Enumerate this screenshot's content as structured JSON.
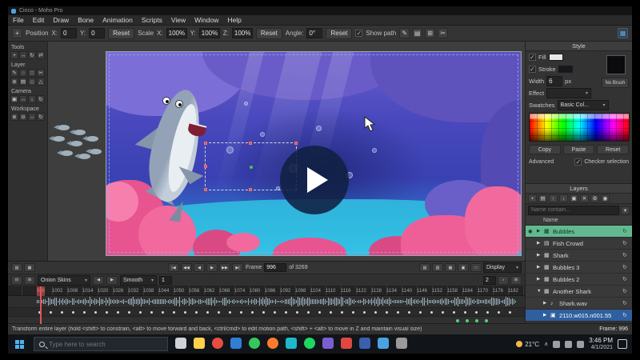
{
  "window": {
    "title": "Cinco - Moho Pro",
    "menus": [
      {
        "label": "File"
      },
      {
        "label": "Edit"
      },
      {
        "label": "Draw"
      },
      {
        "label": "Bone"
      },
      {
        "label": "Animation"
      },
      {
        "label": "Scripts"
      },
      {
        "label": "View"
      },
      {
        "label": "Window"
      },
      {
        "label": "Help"
      }
    ]
  },
  "transform_toolbar": {
    "position_label": "Position",
    "position_fields": [
      {
        "label": "X:",
        "value": "0"
      },
      {
        "label": "Y:",
        "value": "0"
      }
    ],
    "reset_label": "Reset",
    "scale_label": "Scale",
    "scale_fields": [
      {
        "label": "X:",
        "value": "100%"
      },
      {
        "label": "Y:",
        "value": "100%"
      },
      {
        "label": "Z:",
        "value": "100%"
      }
    ],
    "angle_label": "Angle:",
    "angle_value": "0°",
    "show_path_label": "Show path",
    "icons": [
      {
        "name": "freehand-icon",
        "glyph": "✎"
      },
      {
        "name": "layer-stack-icon",
        "glyph": "▤"
      },
      {
        "name": "grid-icon",
        "glyph": "⊞"
      },
      {
        "name": "scissors-icon",
        "glyph": "✂"
      }
    ],
    "dock_icon": {
      "name": "dock-layout-icon",
      "glyph": "▦"
    }
  },
  "tools_panel": {
    "title": "Tools",
    "sections": [
      {
        "label": "",
        "icons": [
          {
            "name": "transform-tool",
            "glyph": "+"
          },
          {
            "name": "translate-tool",
            "glyph": "↔"
          },
          {
            "name": "rotate-tool",
            "glyph": "↻"
          },
          {
            "name": "scale-tool",
            "glyph": "⇄"
          }
        ]
      },
      {
        "label": "Layer",
        "icons": [
          {
            "name": "draw-tool",
            "glyph": "✎"
          },
          {
            "name": "ellipse-tool",
            "glyph": "○"
          },
          {
            "name": "rectangle-tool",
            "glyph": "□"
          },
          {
            "name": "cut-tool",
            "glyph": "✂"
          },
          {
            "name": "add-point-tool",
            "glyph": "⊕"
          },
          {
            "name": "fill-tool",
            "glyph": "▤"
          },
          {
            "name": "shape-tool",
            "glyph": "◇"
          },
          {
            "name": "polygon-tool",
            "glyph": "△"
          }
        ]
      },
      {
        "label": "Camera",
        "icons": [
          {
            "name": "camera-track-tool",
            "glyph": "▣"
          },
          {
            "name": "camera-pan-tool",
            "glyph": "↔"
          },
          {
            "name": "camera-tilt-tool",
            "glyph": "↕"
          },
          {
            "name": "camera-roll-tool",
            "glyph": "↻"
          }
        ]
      },
      {
        "label": "Workspace",
        "icons": [
          {
            "name": "zoom-in-tool",
            "glyph": "⊕"
          },
          {
            "name": "zoom-out-tool",
            "glyph": "⊖"
          },
          {
            "name": "pan-workspace-tool",
            "glyph": "↔"
          },
          {
            "name": "orbit-workspace-tool",
            "glyph": "↻"
          }
        ]
      }
    ]
  },
  "style_panel": {
    "title": "Style",
    "fill_label": "Fill",
    "stroke_label": "Stroke",
    "width_label": "Width",
    "width_value": "6",
    "width_unit": "px",
    "effect_label": "Effect",
    "no_brush_label": "No Brush",
    "swatches_label": "Swatches",
    "swatches_value": "Basic Col...",
    "copy_label": "Copy",
    "paste_label": "Paste",
    "reset_label": "Reset",
    "advanced_label": "Advanced",
    "checker_label": "Checker selection"
  },
  "layers_panel": {
    "title": "Layers",
    "header_icons": [
      {
        "name": "new-layer-icon",
        "glyph": "+"
      },
      {
        "name": "folder-icon",
        "glyph": "▤"
      },
      {
        "name": "move-up-icon",
        "glyph": "↑"
      },
      {
        "name": "move-down-icon",
        "glyph": "↓"
      },
      {
        "name": "duplicate-icon",
        "glyph": "▣"
      },
      {
        "name": "delete-icon",
        "glyph": "✕"
      },
      {
        "name": "settings-gear-icon",
        "glyph": "⚙"
      },
      {
        "name": "visibility-icon",
        "glyph": "◉"
      }
    ],
    "filter_placeholder": "Name contain...",
    "name_column": "Name",
    "rows": [
      {
        "label": "Bubbles",
        "glyph": "▦",
        "icon_name": "group-layer-icon",
        "eye": true,
        "selected": "green",
        "expanded": false,
        "indent": 0
      },
      {
        "label": "Fish Crowd",
        "glyph": "▤",
        "icon_name": "folder-layer-icon",
        "eye": false,
        "selected": "",
        "expanded": false,
        "indent": 0
      },
      {
        "label": "Shark",
        "glyph": "▦",
        "icon_name": "group-layer-icon",
        "eye": false,
        "selected": "",
        "expanded": false,
        "indent": 0
      },
      {
        "label": "Bubbles 3",
        "glyph": "▦",
        "icon_name": "group-layer-icon",
        "eye": false,
        "selected": "",
        "expanded": false,
        "indent": 0
      },
      {
        "label": "Bubbles 2",
        "glyph": "▦",
        "icon_name": "group-layer-icon",
        "eye": false,
        "selected": "",
        "expanded": false,
        "indent": 0
      },
      {
        "label": "Another Shark",
        "glyph": "▦",
        "icon_name": "group-layer-icon",
        "eye": false,
        "selected": "",
        "expanded": true,
        "indent": 0
      },
      {
        "label": "Shark.wav",
        "glyph": "♪",
        "icon_name": "audio-layer-icon",
        "eye": false,
        "selected": "",
        "expanded": false,
        "indent": 1
      },
      {
        "label": "2110.w015.n001.55",
        "glyph": "▣",
        "icon_name": "image-layer-icon",
        "eye": false,
        "selected": "blue",
        "expanded": false,
        "indent": 1
      }
    ]
  },
  "timeline": {
    "left_icons": [
      {
        "name": "timeline-settings-icon",
        "glyph": "▤"
      },
      {
        "name": "timeline-options-icon",
        "glyph": "▦"
      }
    ],
    "playback_buttons": [
      {
        "name": "jump-start-button",
        "glyph": "|◀"
      },
      {
        "name": "prev-keyframe-button",
        "glyph": "◀◀"
      },
      {
        "name": "step-back-button",
        "glyph": "◀"
      },
      {
        "name": "play-button",
        "glyph": "▶"
      },
      {
        "name": "step-forward-button",
        "glyph": "▶▶"
      },
      {
        "name": "jump-end-button",
        "glyph": "▶|"
      }
    ],
    "frame_label": "Frame",
    "frame_value": "996",
    "total_label": "of 3269",
    "view_icons": [
      {
        "name": "view-mode-1-icon",
        "glyph": "▤"
      },
      {
        "name": "view-mode-2-icon",
        "glyph": "▥"
      },
      {
        "name": "view-mode-3-icon",
        "glyph": "▦"
      },
      {
        "name": "view-mode-4-icon",
        "glyph": "▣"
      },
      {
        "name": "view-mode-5-icon",
        "glyph": "□"
      }
    ],
    "display_label": "Display",
    "onion_icons": [
      {
        "name": "onion-before-icon",
        "glyph": "⊟"
      },
      {
        "name": "onion-after-icon",
        "glyph": "⊞"
      }
    ],
    "onion_label": "Onion Skins",
    "prev_arrow": "◀",
    "next_arrow": "▶",
    "smooth_label": "Smooth",
    "smooth_value": "1",
    "channel_value": "2",
    "extra_icons": [
      {
        "name": "audio-track-icon",
        "glyph": "♪"
      },
      {
        "name": "keyframe-grid-icon",
        "glyph": "⊞"
      }
    ],
    "ruler_frames": [
      "996",
      "1002",
      "1008",
      "1014",
      "1020",
      "1026",
      "1032",
      "1038",
      "1044",
      "1050",
      "1056",
      "1062",
      "1068",
      "1074",
      "1080",
      "1086",
      "1092",
      "1098",
      "1104",
      "1110",
      "1116",
      "1122",
      "1128",
      "1134",
      "1140",
      "1146",
      "1152",
      "1158",
      "1164",
      "1170",
      "1176",
      "1182"
    ]
  },
  "status_bar": {
    "hint": "Transform entire layer (hold <shift> to constrain, <alt> to move forward and back, <ctrl/cmd> to edit motion path, <shift> + <alt> to move in Z and maintain visual size)",
    "frame": "Frame: 996"
  },
  "taskbar": {
    "search_placeholder": "Type here to search",
    "apps": [
      {
        "name": "task-view",
        "color": "#cfd3d8",
        "round": false
      },
      {
        "name": "file-explorer",
        "color": "#ffd04a",
        "round": false
      },
      {
        "name": "browser",
        "color": "#e84e40",
        "round": true
      },
      {
        "name": "app-blue",
        "color": "#2f7fd4",
        "round": false
      },
      {
        "name": "chat-green",
        "color": "#35c75a",
        "round": true
      },
      {
        "name": "app-orange",
        "color": "#ff7b2e",
        "round": true
      },
      {
        "name": "app-teal",
        "color": "#1fb8c9",
        "round": false
      },
      {
        "name": "music-green",
        "color": "#1ed760",
        "round": true
      },
      {
        "name": "app-purple",
        "color": "#7a5fd0",
        "round": false
      },
      {
        "name": "app-red",
        "color": "#e0483f",
        "round": false
      },
      {
        "name": "app-navy",
        "color": "#3a5fae",
        "round": false
      },
      {
        "name": "mail",
        "color": "#4aa3e0",
        "round": false
      },
      {
        "name": "app-gray",
        "color": "#9a9a9a",
        "round": false
      }
    ],
    "temperature": "21°C",
    "tray_chevron": "∧",
    "time": "3:46 PM",
    "date": "4/1/2021"
  }
}
